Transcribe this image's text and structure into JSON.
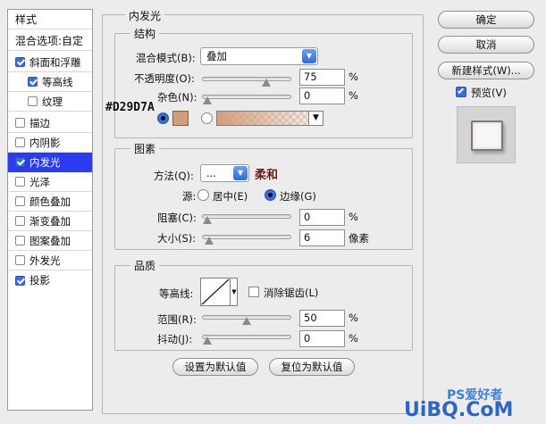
{
  "sidebar": {
    "header": "样式",
    "blend_options": "混合选项:自定",
    "items": [
      {
        "label": "斜面和浮雕",
        "checked": true
      },
      {
        "label": "等高线",
        "checked": true
      },
      {
        "label": "纹理",
        "checked": false
      },
      {
        "label": "描边",
        "checked": false
      },
      {
        "label": "内阴影",
        "checked": false
      },
      {
        "label": "内发光",
        "checked": true
      },
      {
        "label": "光泽",
        "checked": false
      },
      {
        "label": "颜色叠加",
        "checked": false
      },
      {
        "label": "渐变叠加",
        "checked": false
      },
      {
        "label": "图案叠加",
        "checked": false
      },
      {
        "label": "外发光",
        "checked": false
      },
      {
        "label": "投影",
        "checked": true
      }
    ]
  },
  "panel": {
    "title": "内发光",
    "structure": {
      "title": "结构",
      "blend_mode_label": "混合模式(B):",
      "blend_mode_value": "叠加",
      "opacity_label": "不透明度(O):",
      "opacity_value": "75",
      "opacity_level": 0.75,
      "noise_label": "杂色(N):",
      "noise_value": "0",
      "noise_level": 0,
      "percent": "%",
      "color_hex": "#D29D7A",
      "color": "#d29d7a"
    },
    "elements": {
      "title": "图素",
      "method_label": "方法(Q):",
      "method_value": "...",
      "method_annotation": "柔和",
      "source_label": "源:",
      "source_center": "居中(E)",
      "source_edge": "边缘(G)",
      "choke_label": "阻塞(C):",
      "choke_value": "0",
      "choke_level": 0,
      "size_label": "大小(S):",
      "size_value": "6",
      "size_unit": "像素",
      "percent": "%"
    },
    "quality": {
      "title": "品质",
      "contour_label": "等高线:",
      "antialias_label": "消除锯齿(L)",
      "range_label": "范围(R):",
      "range_value": "50",
      "range_level": 0.5,
      "jitter_label": "抖动(J):",
      "jitter_value": "0",
      "jitter_level": 0,
      "percent": "%"
    },
    "set_default": "设置为默认值",
    "reset_default": "复位为默认值"
  },
  "buttons": {
    "ok": "确定",
    "cancel": "取消",
    "new_style": "新建样式(W)...",
    "preview": "预览(V)",
    "preview_checked": true
  },
  "watermark": {
    "site_a": "PS爱好者",
    "site_b": "UiBQ.CoM"
  }
}
